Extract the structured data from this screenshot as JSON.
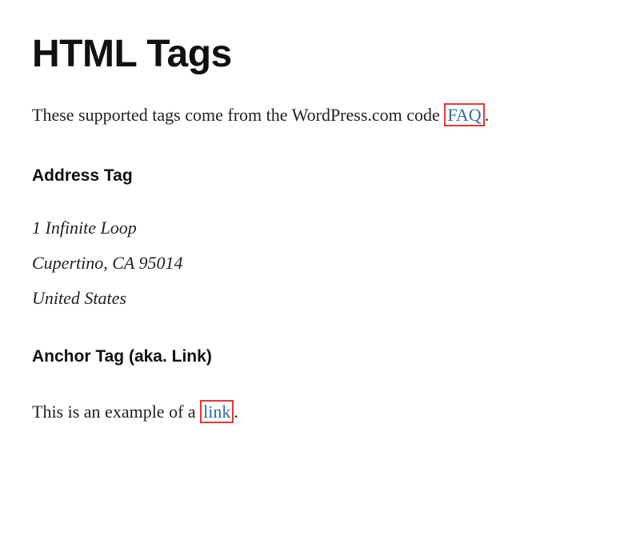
{
  "title": "HTML Tags",
  "intro": {
    "prefix": "These supported tags come from the WordPress.com code ",
    "link_text": "FAQ",
    "suffix": "."
  },
  "sections": {
    "address": {
      "heading": "Address Tag",
      "lines": [
        "1 Infinite Loop",
        "Cupertino, CA 95014",
        "United States"
      ]
    },
    "anchor": {
      "heading": "Anchor Tag (aka. Link)",
      "prefix": "This is an example of a ",
      "link_text": "link",
      "suffix": "."
    }
  }
}
